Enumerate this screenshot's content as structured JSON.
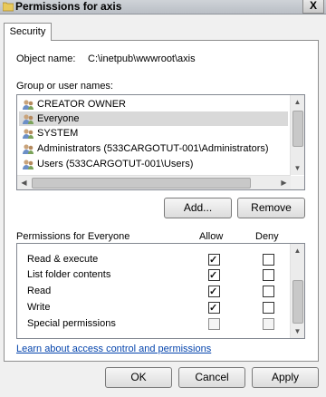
{
  "window": {
    "title": "Permissions for axis",
    "close_label": "X"
  },
  "tabs": [
    {
      "label": "Security"
    }
  ],
  "object_name": {
    "label": "Object name:",
    "value": "C:\\inetpub\\wwwroot\\axis"
  },
  "group_users": {
    "label": "Group or user names:",
    "items": [
      {
        "label": "CREATOR OWNER",
        "selected": false,
        "icon": "users-icon"
      },
      {
        "label": "Everyone",
        "selected": true,
        "icon": "users-icon"
      },
      {
        "label": "SYSTEM",
        "selected": false,
        "icon": "users-icon"
      },
      {
        "label": "Administrators (533CARGOTUT-001\\Administrators)",
        "selected": false,
        "icon": "users-icon"
      },
      {
        "label": "Users (533CARGOTUT-001\\Users)",
        "selected": false,
        "icon": "users-icon"
      }
    ]
  },
  "buttons": {
    "add": "Add...",
    "remove": "Remove",
    "ok": "OK",
    "cancel": "Cancel",
    "apply": "Apply"
  },
  "permissions": {
    "label": "Permissions for Everyone",
    "allow_label": "Allow",
    "deny_label": "Deny",
    "rows": [
      {
        "name": "Read & execute",
        "allow": true,
        "deny": false,
        "disabled": false
      },
      {
        "name": "List folder contents",
        "allow": true,
        "deny": false,
        "disabled": false
      },
      {
        "name": "Read",
        "allow": true,
        "deny": false,
        "disabled": false
      },
      {
        "name": "Write",
        "allow": true,
        "deny": false,
        "disabled": false
      },
      {
        "name": "Special permissions",
        "allow": false,
        "deny": false,
        "disabled": true
      }
    ]
  },
  "help_link": "Learn about access control and permissions"
}
